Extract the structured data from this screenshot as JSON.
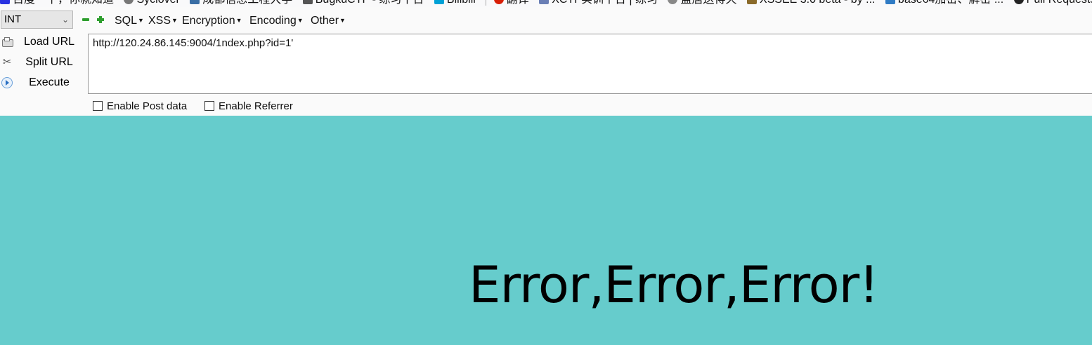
{
  "bookmarks": [
    {
      "label": "百度一下，你就知道",
      "icon": "baidu-icon",
      "color": "#2932e1"
    },
    {
      "label": "Syclover",
      "icon": "globe-icon",
      "color": "#777777"
    },
    {
      "label": "成都信息工程大学",
      "icon": "school-icon",
      "color": "#3a6ea5"
    },
    {
      "label": "BugkuCTF - 练习平台",
      "icon": "bugku-icon",
      "color": "#555555"
    },
    {
      "label": "Bilibili",
      "icon": "bilibili-icon",
      "color": "#00a1d6"
    },
    {
      "label": "翻译",
      "icon": "translate-icon",
      "color": "#d81e06"
    },
    {
      "label": "XCTF实训平台 | 练习",
      "icon": "xctf-icon",
      "color": "#6a7fb5"
    },
    {
      "label": "盖居送得天",
      "icon": "star-icon",
      "color": "#888888"
    },
    {
      "label": "XSSEE 3.0 beta - by ...",
      "icon": "xssee-icon",
      "color": "#8a6a2a"
    },
    {
      "label": "base64加密、解密 ...",
      "icon": "base64-icon",
      "color": "#2f7bc4"
    },
    {
      "label": "Pull Requests",
      "icon": "github-icon",
      "color": "#222222"
    }
  ],
  "hackbar": {
    "select_value": "INT",
    "menus": [
      {
        "label": "SQL"
      },
      {
        "label": "XSS"
      },
      {
        "label": "Encryption"
      },
      {
        "label": "Encoding"
      },
      {
        "label": "Other"
      }
    ],
    "buttons": {
      "load": "Load URL",
      "split": "Split URL",
      "execute": "Execute"
    },
    "url": "http://120.24.86.145:9004/1ndex.php?id=1'",
    "checkboxes": {
      "post": {
        "label": "Enable Post data",
        "checked": false
      },
      "referrer": {
        "label": "Enable Referrer",
        "checked": false
      }
    }
  },
  "page": {
    "background": "#66cccc",
    "message": "Error,Error,Error!"
  }
}
